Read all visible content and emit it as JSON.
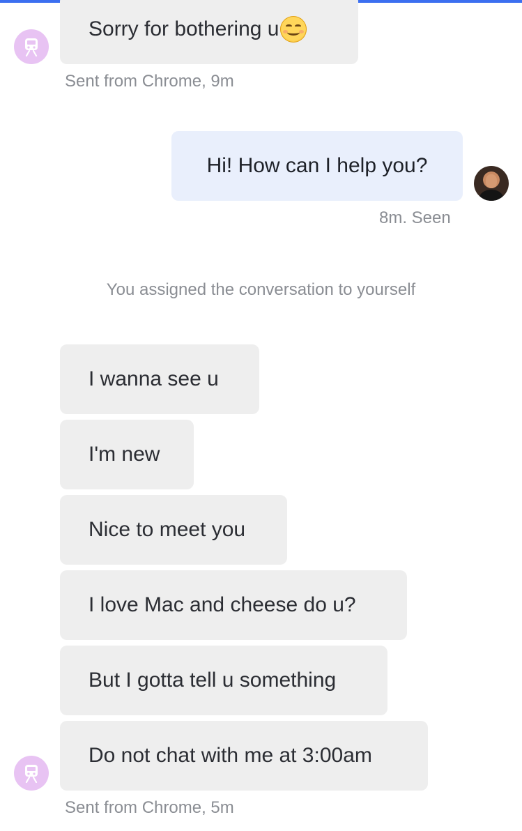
{
  "thread": {
    "messages_top": {
      "first": {
        "text": "Sorry for bothering u",
        "emoji": "smiling-face-icon"
      },
      "first_meta": "Sent from Chrome, 9m",
      "reply": "Hi! How can I help you?",
      "reply_meta": "8m. Seen"
    },
    "system_note": "You assigned the conversation to yourself",
    "messages_bottom": [
      "I wanna see u",
      "I'm new",
      "Nice to meet you",
      "I love Mac and cheese do u?",
      "But I gotta tell u something",
      "Do not chat with me at 3:00am"
    ],
    "last_meta": "Sent from Chrome, 5m"
  },
  "icons": {
    "visitor_avatar": "train-icon",
    "agent_avatar": "user-photo-avatar"
  },
  "colors": {
    "accent": "#3b6ff0",
    "incoming_bubble": "#eeeeee",
    "outgoing_bubble": "#e9effc",
    "visitor_avatar_bg": "#e8c3f3"
  }
}
